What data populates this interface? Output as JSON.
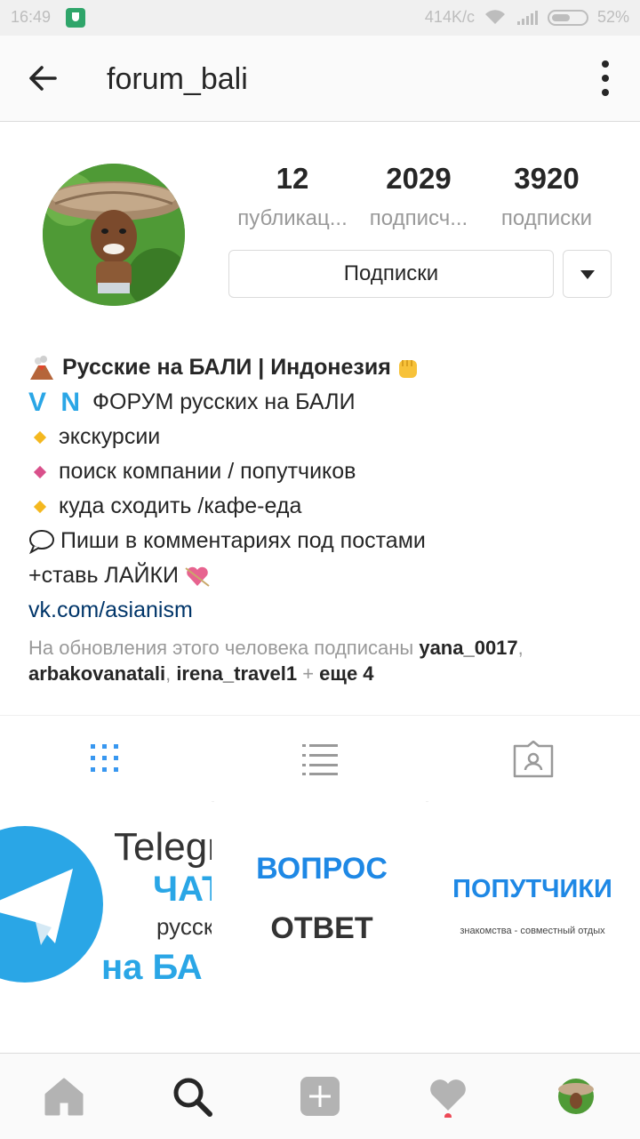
{
  "status_bar": {
    "time": "16:49",
    "speed": "414K/c",
    "battery": "52%"
  },
  "app_bar": {
    "username": "forum_bali"
  },
  "stats": [
    {
      "count": "12",
      "label": "публикац..."
    },
    {
      "count": "2029",
      "label": "подписч..."
    },
    {
      "count": "3920",
      "label": "подписки"
    }
  ],
  "actions": {
    "follow_label": "Подписки"
  },
  "bio": {
    "name": "Русские на БАЛИ | Индонезия",
    "vn_letters": "V N",
    "line2": "ФОРУМ русских на БАЛИ",
    "line3": "экскурсии",
    "line4": "поиск компании / попутчиков",
    "line5": "куда сходить /кафе-еда",
    "line6": "Пиши в комментариях под постами",
    "line7": "+ставь ЛАЙКИ",
    "link": "vk.com/asianism"
  },
  "followed_by": {
    "prefix": "На обновления этого человека подписаны",
    "user1": "yana_0017",
    "user2": "arbakovanatali",
    "user3": "irena_travel1",
    "more": "еще 4"
  },
  "posts": [
    {
      "line1": "Telegr",
      "line2": "ЧАТ",
      "line3": "русск",
      "line4": "на БА"
    },
    {
      "line1": "ВОПРОС",
      "line2": "ОТВЕТ"
    },
    {
      "line1": "ПОПУТЧИКИ",
      "line2": "знакомства - совместный отдых"
    }
  ],
  "icons": {
    "back": "arrow-left-icon",
    "more": "more-vertical-icon",
    "grid": "grid-icon",
    "list": "list-icon",
    "tagged": "tagged-icon",
    "home": "home-icon",
    "search": "search-icon",
    "add": "add-icon",
    "activity": "heart-icon",
    "profile": "profile-icon"
  },
  "colors": {
    "accent": "#3897f0",
    "link": "#003569",
    "muted": "#999999",
    "telegram": "#2aa6e6",
    "notification": "#ed4956"
  }
}
